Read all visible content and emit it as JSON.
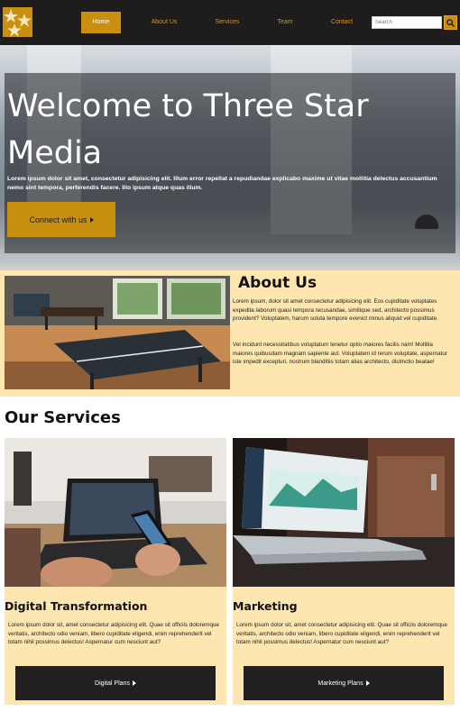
{
  "nav": {
    "logo_icon": "three-stars-logo",
    "links": [
      {
        "label": "Home",
        "active": true
      },
      {
        "label": "About Us",
        "active": false
      },
      {
        "label": "Services",
        "active": false
      },
      {
        "label": "Team",
        "active": false
      },
      {
        "label": "Contact",
        "active": false
      }
    ],
    "search": {
      "placeholder": "Search",
      "icon": "search-icon"
    }
  },
  "hero": {
    "title": "Welcome to Three Star Media",
    "text": "Lorem ipsum dolor sit amet, consectetur adipisicing elit. Illum error repellat a repudiandae explicabo maxime ut vitae mollitia delectus accusantium nemo sint tempora, perferendis facere. Illo ipsum atque quas illum.",
    "cta_label": "Connect with us",
    "cta_icon": "caret-right-icon"
  },
  "about": {
    "title": "About Us",
    "paragraphs": [
      "Lorem ipsum, dolor sit amet consectetur adipisicing elit. Eos cupiditate voluptates expedita laborum quasi tempora recusandae, similique sed, architecto possimus provident? Voluptatem, harum soluta tempore evenict minus aliquid vel cupiditate.",
      "Vel incidunt necessitatibus voluptatum tenetur optio maiores facilis nam! Mollitia maiores quibusdam magnam sapiente aut. Voluptatem id rerum voluptate, aspernatur iste impedit excepturi, nostrum blanditiis totam alias architecto, distinctio beatae!"
    ]
  },
  "services": {
    "title": "Our Services",
    "cards": [
      {
        "title": "Digital Transformation",
        "text": "Lorem ipsum dolor sit, amet consectetur adipisicing elit. Quae sit officiis doloremque veritatis, architecto odio veniam, libero cupiditate eligendi, enim reprehenderit vel totam nihil possimus delectus! Aspernatur cum nesciunt aut?",
        "button": "Digital Plans"
      },
      {
        "title": "Marketing",
        "text": "Lorem ipsum dolor sit, amet consectetur adipisicing elit. Quae sit officiis doloremque veritatis, architecto odio veniam, libero cupiditate eligendi, enim reprehenderit vel totam nihil possimus delectus! Aspernatur cum nesciunt aut?",
        "button": "Marketing Plans"
      }
    ]
  },
  "colors": {
    "accent": "#c98f10",
    "nav_bg": "#1e1c1d",
    "panel_bg": "#fde6b0",
    "button_dark": "#211f20"
  }
}
